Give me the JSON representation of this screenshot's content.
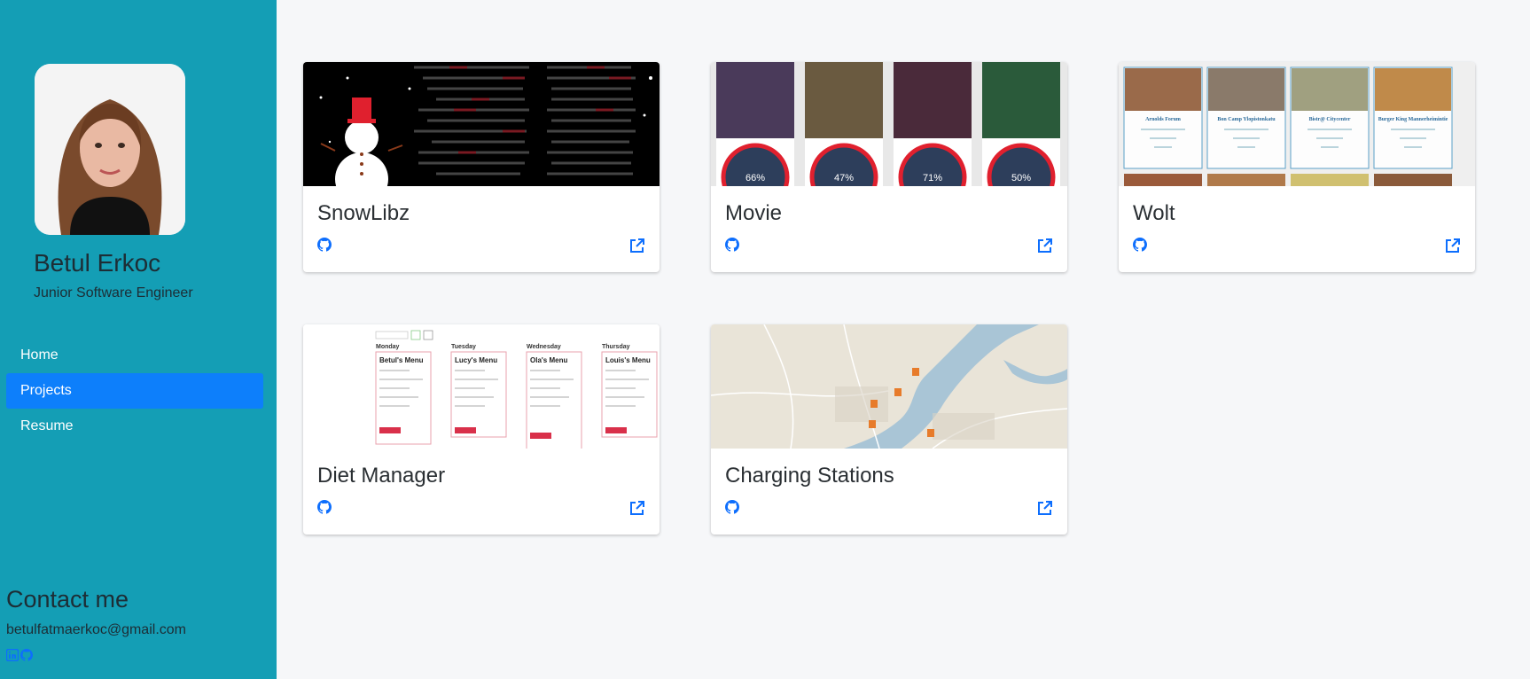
{
  "profile": {
    "name": "Betul Erkoc",
    "role": "Junior Software Engineer"
  },
  "nav": {
    "items": [
      {
        "label": "Home",
        "active": false
      },
      {
        "label": "Projects",
        "active": true
      },
      {
        "label": "Resume",
        "active": false
      }
    ]
  },
  "contact": {
    "title": "Contact me",
    "email": "betulfatmaerkoc@gmail.com",
    "icons": [
      "linkedin-icon",
      "github-icon"
    ]
  },
  "projects": [
    {
      "title": "SnowLibz"
    },
    {
      "title": "Movie",
      "ratings": [
        "66%",
        "47%",
        "71%",
        "50%"
      ]
    },
    {
      "title": "Wolt",
      "places": [
        "Arnolds Forum",
        "Bon Camp Ylopistonkatu",
        "Bistr@ Citycenter",
        "Burger King Mannerheimintie"
      ]
    },
    {
      "title": "Diet Manager",
      "days": [
        "Monday",
        "Tuesday",
        "Wednesday",
        "Thursday"
      ],
      "menus": [
        "Betul's Menu",
        "Lucy's Menu",
        "Ola's Menu",
        "Louis's Menu"
      ]
    },
    {
      "title": "Charging Stations"
    }
  ],
  "colors": {
    "sidebar": "#149eb5",
    "active_nav": "#0d7ffb",
    "link_icon": "#0d6efd",
    "page_bg": "#f6f7f9"
  }
}
